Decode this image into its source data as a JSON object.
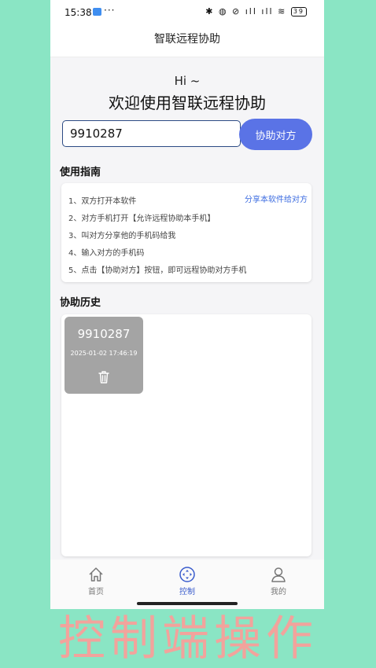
{
  "status_bar": {
    "time": "15:38",
    "notification_dots": "···",
    "indicators": "✱ ◍ ⊘ ıll ıll ≋",
    "battery": "39"
  },
  "nav": {
    "title": "智联远程协助"
  },
  "welcome": {
    "hi": "Hi ~",
    "title": "欢迎使用智联远程协助"
  },
  "connect": {
    "code_value": "9910287",
    "assist_button": "协助对方"
  },
  "guide": {
    "title": "使用指南",
    "share_link": "分享本软件给对方",
    "steps": [
      "1、双方打开本软件",
      "2、对方手机打开【允许远程协助本手机】",
      "3、叫对方分享他的手机码给我",
      "4、输入对方的手机码",
      "5、点击【协助对方】按钮，即可远程协助对方手机"
    ]
  },
  "history": {
    "title": "协助历史",
    "items": [
      {
        "code": "9910287",
        "time": "2025-01-02 17:46:19"
      }
    ]
  },
  "tabs": [
    {
      "label": "首页",
      "icon": "home-icon",
      "active": false
    },
    {
      "label": "控制",
      "icon": "control-icon",
      "active": true
    },
    {
      "label": "我的",
      "icon": "profile-icon",
      "active": false
    }
  ],
  "caption": "控制端操作",
  "colors": {
    "background": "#8ae5c4",
    "accent": "#5a73e6",
    "active_tab": "#3a5ccc",
    "link": "#3b6be0",
    "history_tile": "#a4a4a4",
    "caption": "#f2a39c"
  }
}
